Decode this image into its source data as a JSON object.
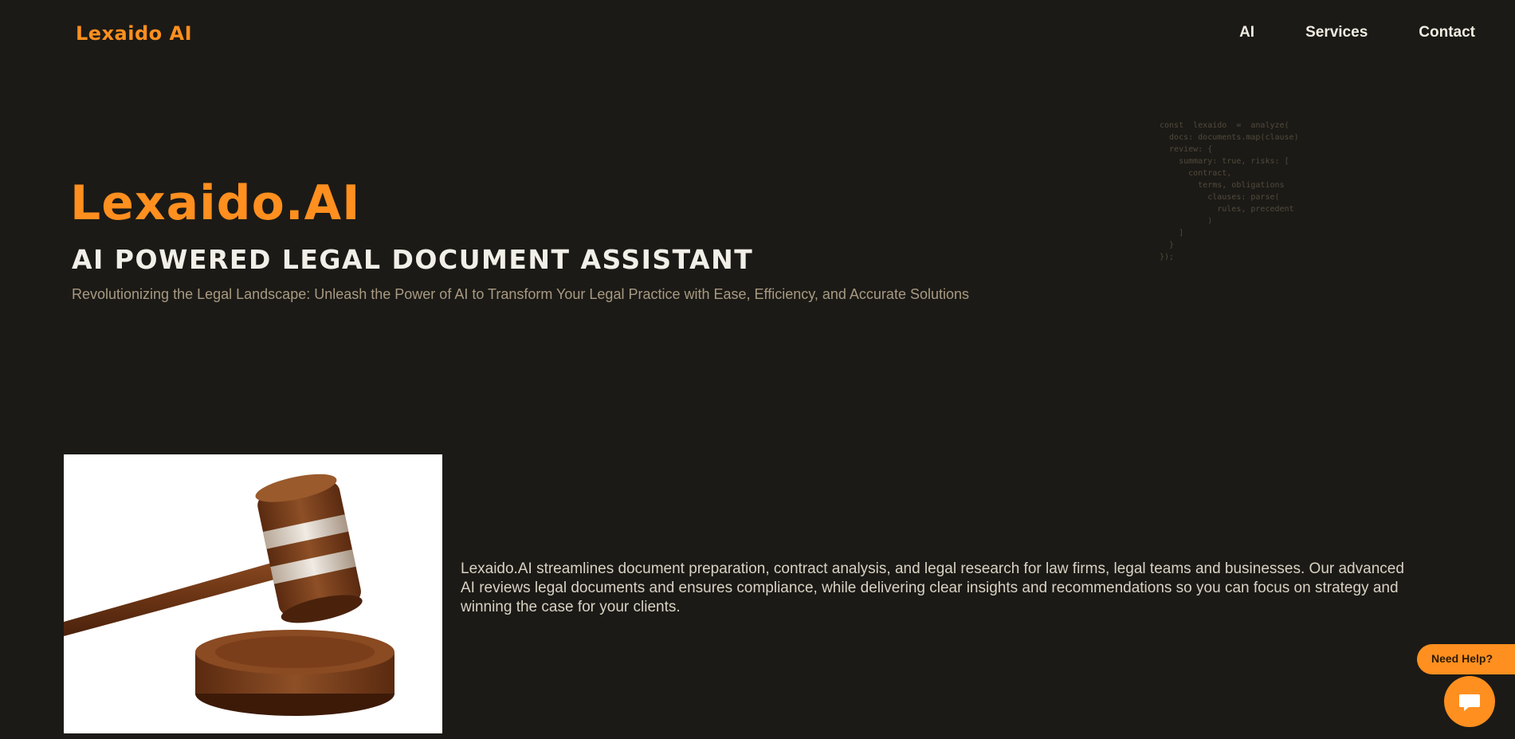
{
  "header": {
    "logo": "Lexaido AI",
    "nav": [
      {
        "label": "AI"
      },
      {
        "label": "Services"
      },
      {
        "label": "Contact"
      }
    ]
  },
  "hero": {
    "title": "Lexaido.AI",
    "subtitle": "AI POWERED LEGAL DOCUMENT ASSISTANT",
    "tagline": "Revolutionizing the Legal Landscape: Unleash the Power of AI to Transform Your Legal Practice with Ease, Efficiency, and Accurate Solutions"
  },
  "code_block": {
    "lines": [
      "const  lexaido  =  analyze(",
      "  docs: documents.map(clause)",
      "  review: {",
      "    summary: true, risks: [",
      "      contract,",
      "        terms, obligations",
      "          clauses: parse(",
      "            rules, precedent",
      "          )",
      "    ]",
      "  }",
      "});"
    ]
  },
  "about": {
    "text": "Lexaido.AI streamlines document preparation, contract analysis, and legal research for law firms, legal teams and businesses. Our advanced AI reviews legal documents and ensures compliance, while delivering clear insights and recommendations so you can focus on strategy and winning the case for your clients."
  },
  "gavel_image": {
    "alt": "gavel"
  },
  "chat": {
    "label": "Need Help?"
  },
  "colors": {
    "background": "#1c1a16",
    "accent": "#ff8f1f",
    "text": "#f2efe8",
    "muted": "#a79a82"
  }
}
